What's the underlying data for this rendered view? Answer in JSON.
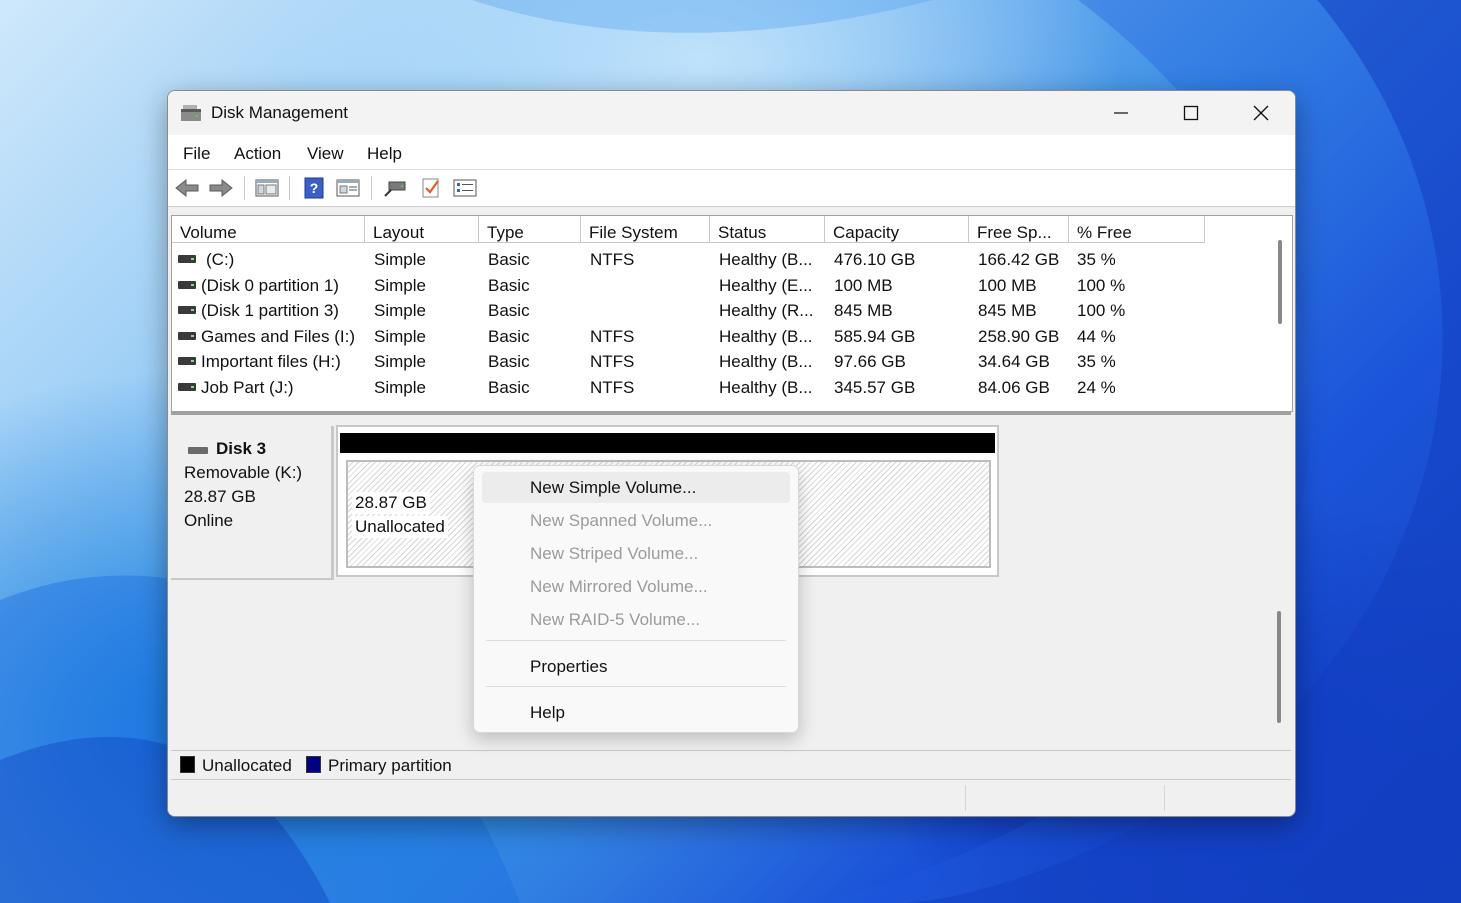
{
  "window": {
    "title": "Disk Management"
  },
  "menubar": {
    "items": [
      "File",
      "Action",
      "View",
      "Help"
    ]
  },
  "toolbar": {
    "buttons": [
      "back-icon",
      "forward-icon",
      "console-tree-icon",
      "help-icon",
      "properties-icon",
      "connect-icon",
      "check-icon",
      "settings-list-icon"
    ]
  },
  "volume_table": {
    "columns": [
      "Volume",
      "Layout",
      "Type",
      "File System",
      "Status",
      "Capacity",
      "Free Sp...",
      "% Free"
    ],
    "rows": [
      [
        "(C:)",
        "Simple",
        "Basic",
        "NTFS",
        "Healthy (B...",
        "476.10 GB",
        "166.42 GB",
        "35 %"
      ],
      [
        "(Disk 0 partition 1)",
        "Simple",
        "Basic",
        "",
        "Healthy (E...",
        "100 MB",
        "100 MB",
        "100 %"
      ],
      [
        "(Disk 1 partition 3)",
        "Simple",
        "Basic",
        "",
        "Healthy (R...",
        "845 MB",
        "845 MB",
        "100 %"
      ],
      [
        "Games and Files (I:)",
        "Simple",
        "Basic",
        "NTFS",
        "Healthy (B...",
        "585.94 GB",
        "258.90 GB",
        "44 %"
      ],
      [
        "Important files (H:)",
        "Simple",
        "Basic",
        "NTFS",
        "Healthy (B...",
        "97.66 GB",
        "34.64 GB",
        "35 %"
      ],
      [
        "Job Part (J:)",
        "Simple",
        "Basic",
        "NTFS",
        "Healthy (B...",
        "345.57 GB",
        "84.06 GB",
        "24 %"
      ]
    ]
  },
  "disk": {
    "name": "Disk 3",
    "type": "Removable (K:)",
    "size": "28.87 GB",
    "state": "Online",
    "partition": {
      "size": "28.87 GB",
      "label": "Unallocated"
    }
  },
  "legend": {
    "items": [
      {
        "label": "Unallocated",
        "color": "#000000"
      },
      {
        "label": "Primary partition",
        "color": "#000080"
      }
    ]
  },
  "context_menu": {
    "items": [
      {
        "label": "New Simple Volume...",
        "enabled": true,
        "highlighted": true
      },
      {
        "label": "New Spanned Volume...",
        "enabled": false
      },
      {
        "label": "New Striped Volume...",
        "enabled": false
      },
      {
        "label": "New Mirrored Volume...",
        "enabled": false
      },
      {
        "label": "New RAID-5 Volume...",
        "enabled": false
      },
      {
        "label": "Properties",
        "enabled": true
      },
      {
        "label": "Help",
        "enabled": true
      }
    ]
  }
}
